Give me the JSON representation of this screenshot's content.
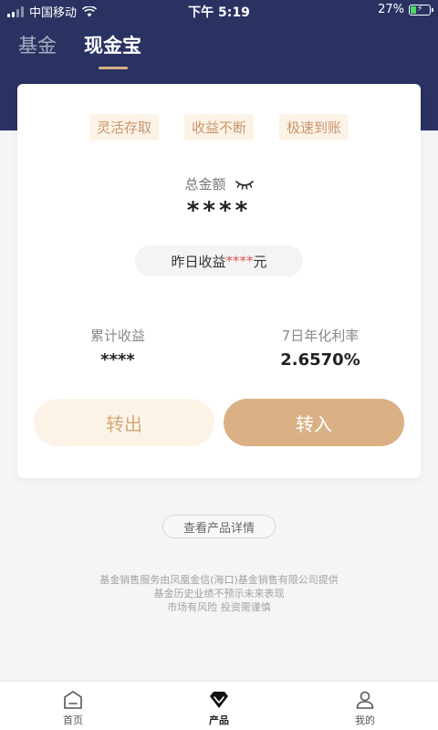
{
  "status_bar": {
    "carrier": "中国移动",
    "time": "下午 5:19",
    "battery": "27%",
    "battery_level": 0.27
  },
  "tabs": [
    {
      "label": "基金",
      "active": false
    },
    {
      "label": "现金宝",
      "active": true
    }
  ],
  "features": [
    "灵活存取",
    "收益不断",
    "极速到账"
  ],
  "total": {
    "label": "总金额",
    "amount": "****"
  },
  "yesterday": {
    "prefix": "昨日收益",
    "masked": "****",
    "suffix": "元"
  },
  "stats": {
    "cumulative_label": "累计收益",
    "cumulative_value": "****",
    "rate_label": "7日年化利率",
    "rate_value": "2.6570%"
  },
  "buttons": {
    "transfer_out": "转出",
    "transfer_in": "转入",
    "detail": "查看产品详情"
  },
  "notes": [
    "基金销售服务由凤凰金信(海口)基金销售有限公司提供",
    "基金历史业绩不预示未来表现",
    "市场有风险 投资需谨慎"
  ],
  "tabbar": [
    {
      "label": "首页",
      "icon": "home-icon",
      "active": false
    },
    {
      "label": "产品",
      "icon": "diamond-icon",
      "active": true
    },
    {
      "label": "我的",
      "icon": "user-icon",
      "active": false
    }
  ],
  "colors": {
    "header_bg": "#2a3262",
    "accent_gold": "#d9b184",
    "feature_bg": "#fcf3e7",
    "masked_red": "#e0574c"
  }
}
